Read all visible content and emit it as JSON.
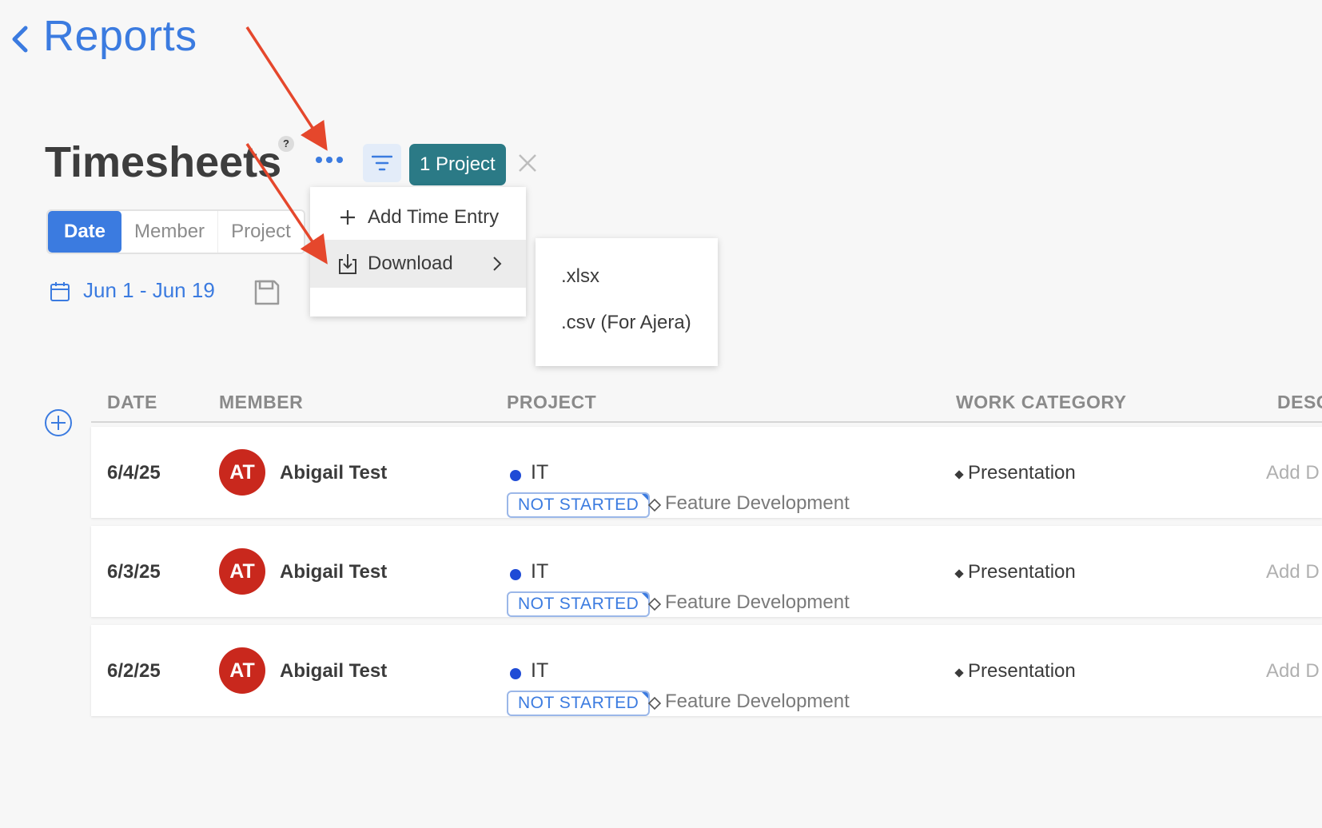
{
  "nav": {
    "back_label": "Reports"
  },
  "header": {
    "title": "Timesheets",
    "help": "?",
    "project_filter_chip": "1 Project"
  },
  "tabs": [
    "Date",
    "Member",
    "Project"
  ],
  "date_range": "Jun 1 - Jun 19",
  "menu": {
    "items": [
      {
        "label": "Add Time Entry",
        "icon": "plus-icon"
      },
      {
        "label": "Download",
        "icon": "download-icon",
        "has_submenu": true
      }
    ],
    "submenu": [
      ".xlsx",
      ".csv (For Ajera)"
    ]
  },
  "table": {
    "columns": [
      "DATE",
      "MEMBER",
      "PROJECT",
      "WORK CATEGORY",
      "DESC"
    ],
    "rows": [
      {
        "date": "6/4/25",
        "initials": "AT",
        "member": "Abigail Test",
        "project": "IT",
        "status": "NOT STARTED",
        "phase": "Feature Development",
        "work_category": "Presentation",
        "description": "Add D"
      },
      {
        "date": "6/3/25",
        "initials": "AT",
        "member": "Abigail Test",
        "project": "IT",
        "status": "NOT STARTED",
        "phase": "Feature Development",
        "work_category": "Presentation",
        "description": "Add D"
      },
      {
        "date": "6/2/25",
        "initials": "AT",
        "member": "Abigail Test",
        "project": "IT",
        "status": "NOT STARTED",
        "phase": "Feature Development",
        "work_category": "Presentation",
        "description": "Add D"
      }
    ]
  },
  "colors": {
    "accent": "#3b7be0",
    "chip": "#2b7a86",
    "avatar": "#c9281d",
    "project_dot": "#1f4bd6",
    "annotation_arrow": "#e5472c"
  }
}
